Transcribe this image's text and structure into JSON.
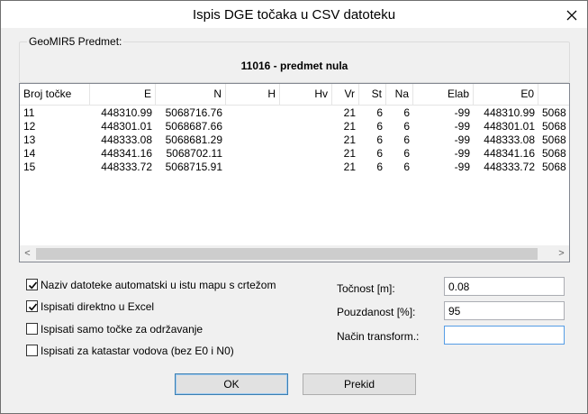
{
  "window": {
    "title": "Ispis DGE točaka u CSV datoteku"
  },
  "predmet": {
    "legend": "GeoMIR5 Predmet:",
    "value": "11016 - predmet nula"
  },
  "table": {
    "columns": [
      "Broj točke",
      "E",
      "N",
      "H",
      "Hv",
      "Vr",
      "St",
      "Na",
      "Elab",
      "E0",
      ""
    ],
    "rows": [
      [
        "11",
        "448310.99",
        "5068716.76",
        "",
        "",
        "21",
        "6",
        "6",
        "-99",
        "448310.99",
        "5068"
      ],
      [
        "12",
        "448301.01",
        "5068687.66",
        "",
        "",
        "21",
        "6",
        "6",
        "-99",
        "448301.01",
        "5068"
      ],
      [
        "13",
        "448333.08",
        "5068681.29",
        "",
        "",
        "21",
        "6",
        "6",
        "-99",
        "448333.08",
        "5068"
      ],
      [
        "14",
        "448341.16",
        "5068702.11",
        "",
        "",
        "21",
        "6",
        "6",
        "-99",
        "448341.16",
        "5068"
      ],
      [
        "15",
        "448333.72",
        "5068715.91",
        "",
        "",
        "21",
        "6",
        "6",
        "-99",
        "448333.72",
        "5068"
      ]
    ]
  },
  "scroll": {
    "left": "<",
    "right": ">"
  },
  "options": [
    {
      "label": "Naziv datoteke automatski u istu mapu s crtežom",
      "checked": true
    },
    {
      "label": "Ispisati direktno u Excel",
      "checked": true
    },
    {
      "label": "Ispisati samo točke za održavanje",
      "checked": false
    },
    {
      "label": "Ispisati za katastar vodova (bez E0 i N0)",
      "checked": false
    }
  ],
  "fields": {
    "tocnost": {
      "label": "Točnost [m]:",
      "value": "0.08"
    },
    "pouzdanost": {
      "label": "Pouzdanost [%]:",
      "value": "95"
    },
    "nacin": {
      "label": "Način transform.:",
      "value": ""
    }
  },
  "buttons": {
    "ok": "OK",
    "cancel": "Prekid"
  }
}
